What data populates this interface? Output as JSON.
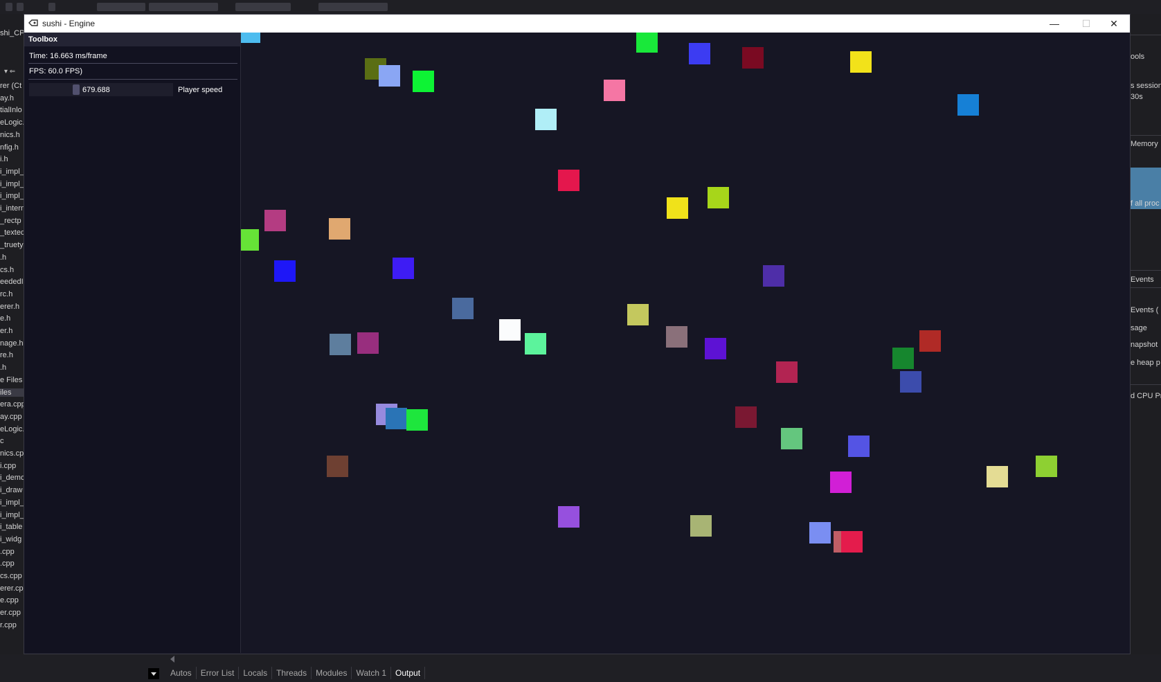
{
  "window": {
    "title": "sushi - Engine",
    "minimize_glyph": "—",
    "maximize_glyph": "☐",
    "close_glyph": "✕"
  },
  "toolbox": {
    "header": "Toolbox",
    "time_text": "Time: 16.663 ms/frame",
    "fps_text": "FPS: 60.0 FPS)",
    "player_speed_value": "679.688",
    "player_speed_label": "Player speed"
  },
  "canvas": {
    "background": "#161624",
    "square_colors": [
      "#4dbcef",
      "#19e83a",
      "#3c3cf2",
      "#7a0a22",
      "#f2e21a",
      "#5a6e14",
      "#8aa6f4",
      "#0df334",
      "#f576a4",
      "#1680d6",
      "#b0eef7",
      "#e4174d",
      "#f0e21a",
      "#a7d61a",
      "#b43c82",
      "#e0a870",
      "#66e337",
      "#1e17f7",
      "#3e1cf4",
      "#4e2ea8",
      "#4a6a9e",
      "#c4c85e",
      "#fbfcfd",
      "#5cf39c",
      "#8a707a",
      "#5d12d4",
      "#5e7e9e",
      "#982e7e",
      "#b02a26",
      "#16862e",
      "#b22452",
      "#3c4cac",
      "#968ade",
      "#2a74b6",
      "#1ee63d",
      "#7a1832",
      "#64c67e",
      "#5454e4",
      "#6e4032",
      "#8ed032",
      "#e4dc94",
      "#d11fd6",
      "#9650de",
      "#a8b474",
      "#7a8ef2",
      "#c05e66",
      "#e41c4c",
      "#ec74f4"
    ]
  },
  "ide": {
    "project_name": "shi_CP",
    "solution_files": [
      "rer (Ct",
      "ay.h",
      "tialInlo",
      "eLogic.",
      "nics.h",
      "nfig.h",
      "i.h",
      "i_impl_",
      "i_impl_",
      "i_impl_",
      "i_intern",
      "_rectp",
      "_texted",
      "_truety",
      ".h",
      "cs.h",
      "eededI",
      "rc.h",
      "erer.h",
      "e.h",
      "er.h",
      "nage.h",
      "re.h",
      ".h",
      "e Files",
      "iles",
      "era.cpp",
      "ay.cpp",
      "eLogic.",
      "c",
      "nics.cp",
      "i.cpp",
      "i_demo",
      "i_draw",
      "i_impl_",
      "i_impl_",
      "i_table",
      "i_widg",
      ".cpp",
      ".cpp",
      "cs.cpp",
      "erer.cp",
      "e.cpp",
      "er.cpp",
      "r.cpp"
    ],
    "right_labels": [
      "ools",
      "s session",
      "30s",
      "Memory",
      "f all proc",
      "Events",
      "Events (",
      "sage",
      "napshot",
      "e heap p",
      "d CPU Pr"
    ],
    "bottom_tabs": [
      "Autos",
      "Error List",
      "Locals",
      "Threads",
      "Modules",
      "Watch 1",
      "Output"
    ],
    "active_tab": "Output"
  }
}
